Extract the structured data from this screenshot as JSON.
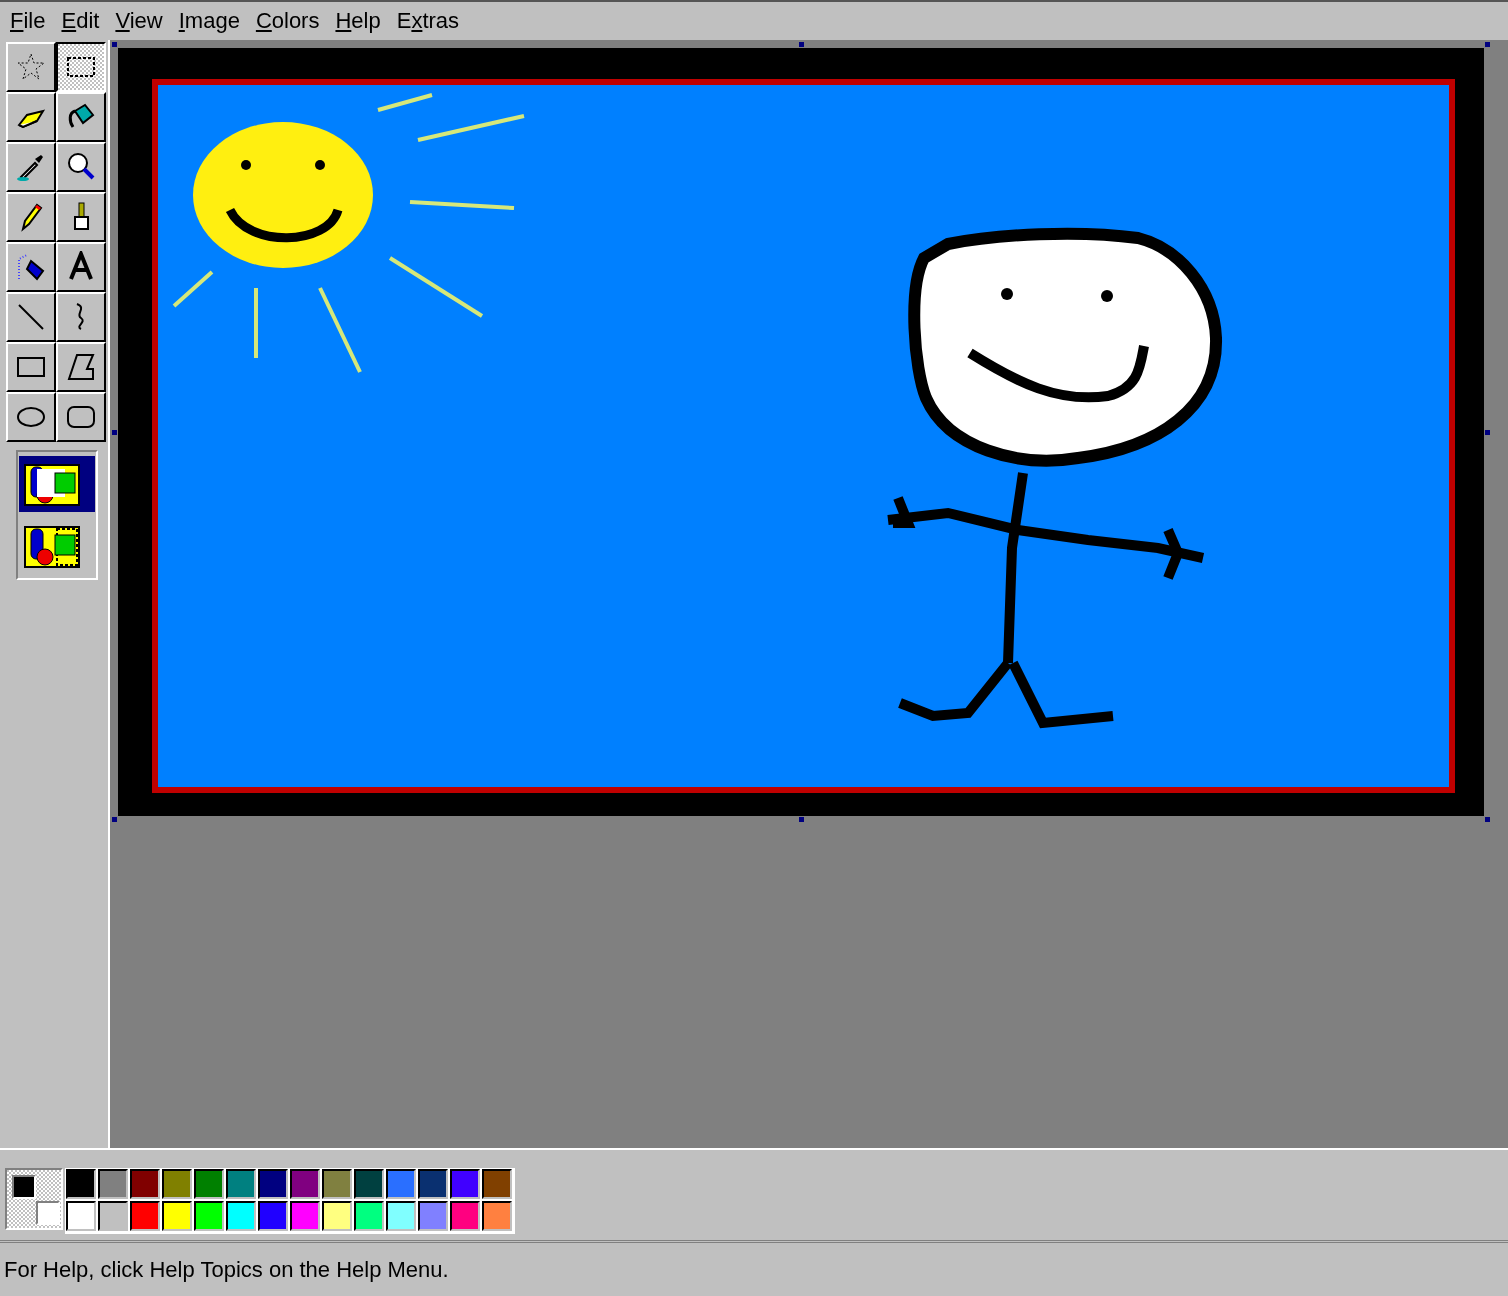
{
  "menu": [
    {
      "key": "F",
      "after": "ile"
    },
    {
      "key": "E",
      "after": "dit"
    },
    {
      "key": "V",
      "after": "iew"
    },
    {
      "key": "I",
      "after": "mage"
    },
    {
      "key": "C",
      "after": "olors"
    },
    {
      "key": "H",
      "after": "elp"
    },
    {
      "before": "E",
      "key": "x",
      "after": "tras"
    }
  ],
  "tools": [
    {
      "kind": "free-select",
      "selected": false
    },
    {
      "kind": "rect-select",
      "selected": true
    },
    {
      "kind": "eraser",
      "selected": false
    },
    {
      "kind": "fill",
      "selected": false
    },
    {
      "kind": "picker",
      "selected": false
    },
    {
      "kind": "magnifier",
      "selected": false
    },
    {
      "kind": "pencil",
      "selected": false
    },
    {
      "kind": "brush",
      "selected": false
    },
    {
      "kind": "airbrush",
      "selected": false
    },
    {
      "kind": "text",
      "selected": false
    },
    {
      "kind": "line",
      "selected": false
    },
    {
      "kind": "curve",
      "selected": false
    },
    {
      "kind": "rectangle",
      "selected": false
    },
    {
      "kind": "polygon",
      "selected": false
    },
    {
      "kind": "ellipse",
      "selected": false
    },
    {
      "kind": "rounded-rectangle",
      "selected": false
    }
  ],
  "tool_options": [
    {
      "kind": "opaque",
      "selected": true
    },
    {
      "kind": "transparent",
      "selected": false
    }
  ],
  "current_colors": {
    "foreground": {
      "color": "#000000"
    },
    "background": {
      "color": "#ffffff"
    }
  },
  "palette": [
    {
      "color": "#000000"
    },
    {
      "color": "#808080"
    },
    {
      "color": "#800000"
    },
    {
      "color": "#808000"
    },
    {
      "color": "#008000"
    },
    {
      "color": "#008080"
    },
    {
      "color": "#000080"
    },
    {
      "color": "#800080"
    },
    {
      "color": "#808040"
    },
    {
      "color": "#004040"
    },
    {
      "color": "#2a6fff"
    },
    {
      "color": "#0a3070"
    },
    {
      "color": "#4000ff"
    },
    {
      "color": "#804000"
    },
    {
      "color": "#ffffff"
    },
    {
      "color": "#c0c0c0"
    },
    {
      "color": "#ff0000"
    },
    {
      "color": "#ffff00"
    },
    {
      "color": "#00ff00"
    },
    {
      "color": "#00ffff"
    },
    {
      "color": "#2000ff"
    },
    {
      "color": "#ff00ff"
    },
    {
      "color": "#ffff80"
    },
    {
      "color": "#00ff80"
    },
    {
      "color": "#80ffff"
    },
    {
      "color": "#8080ff"
    },
    {
      "color": "#ff0080"
    },
    {
      "color": "#ff8040"
    }
  ],
  "status_bar": {
    "text": "For Help, click Help Topics on the Help Menu."
  }
}
